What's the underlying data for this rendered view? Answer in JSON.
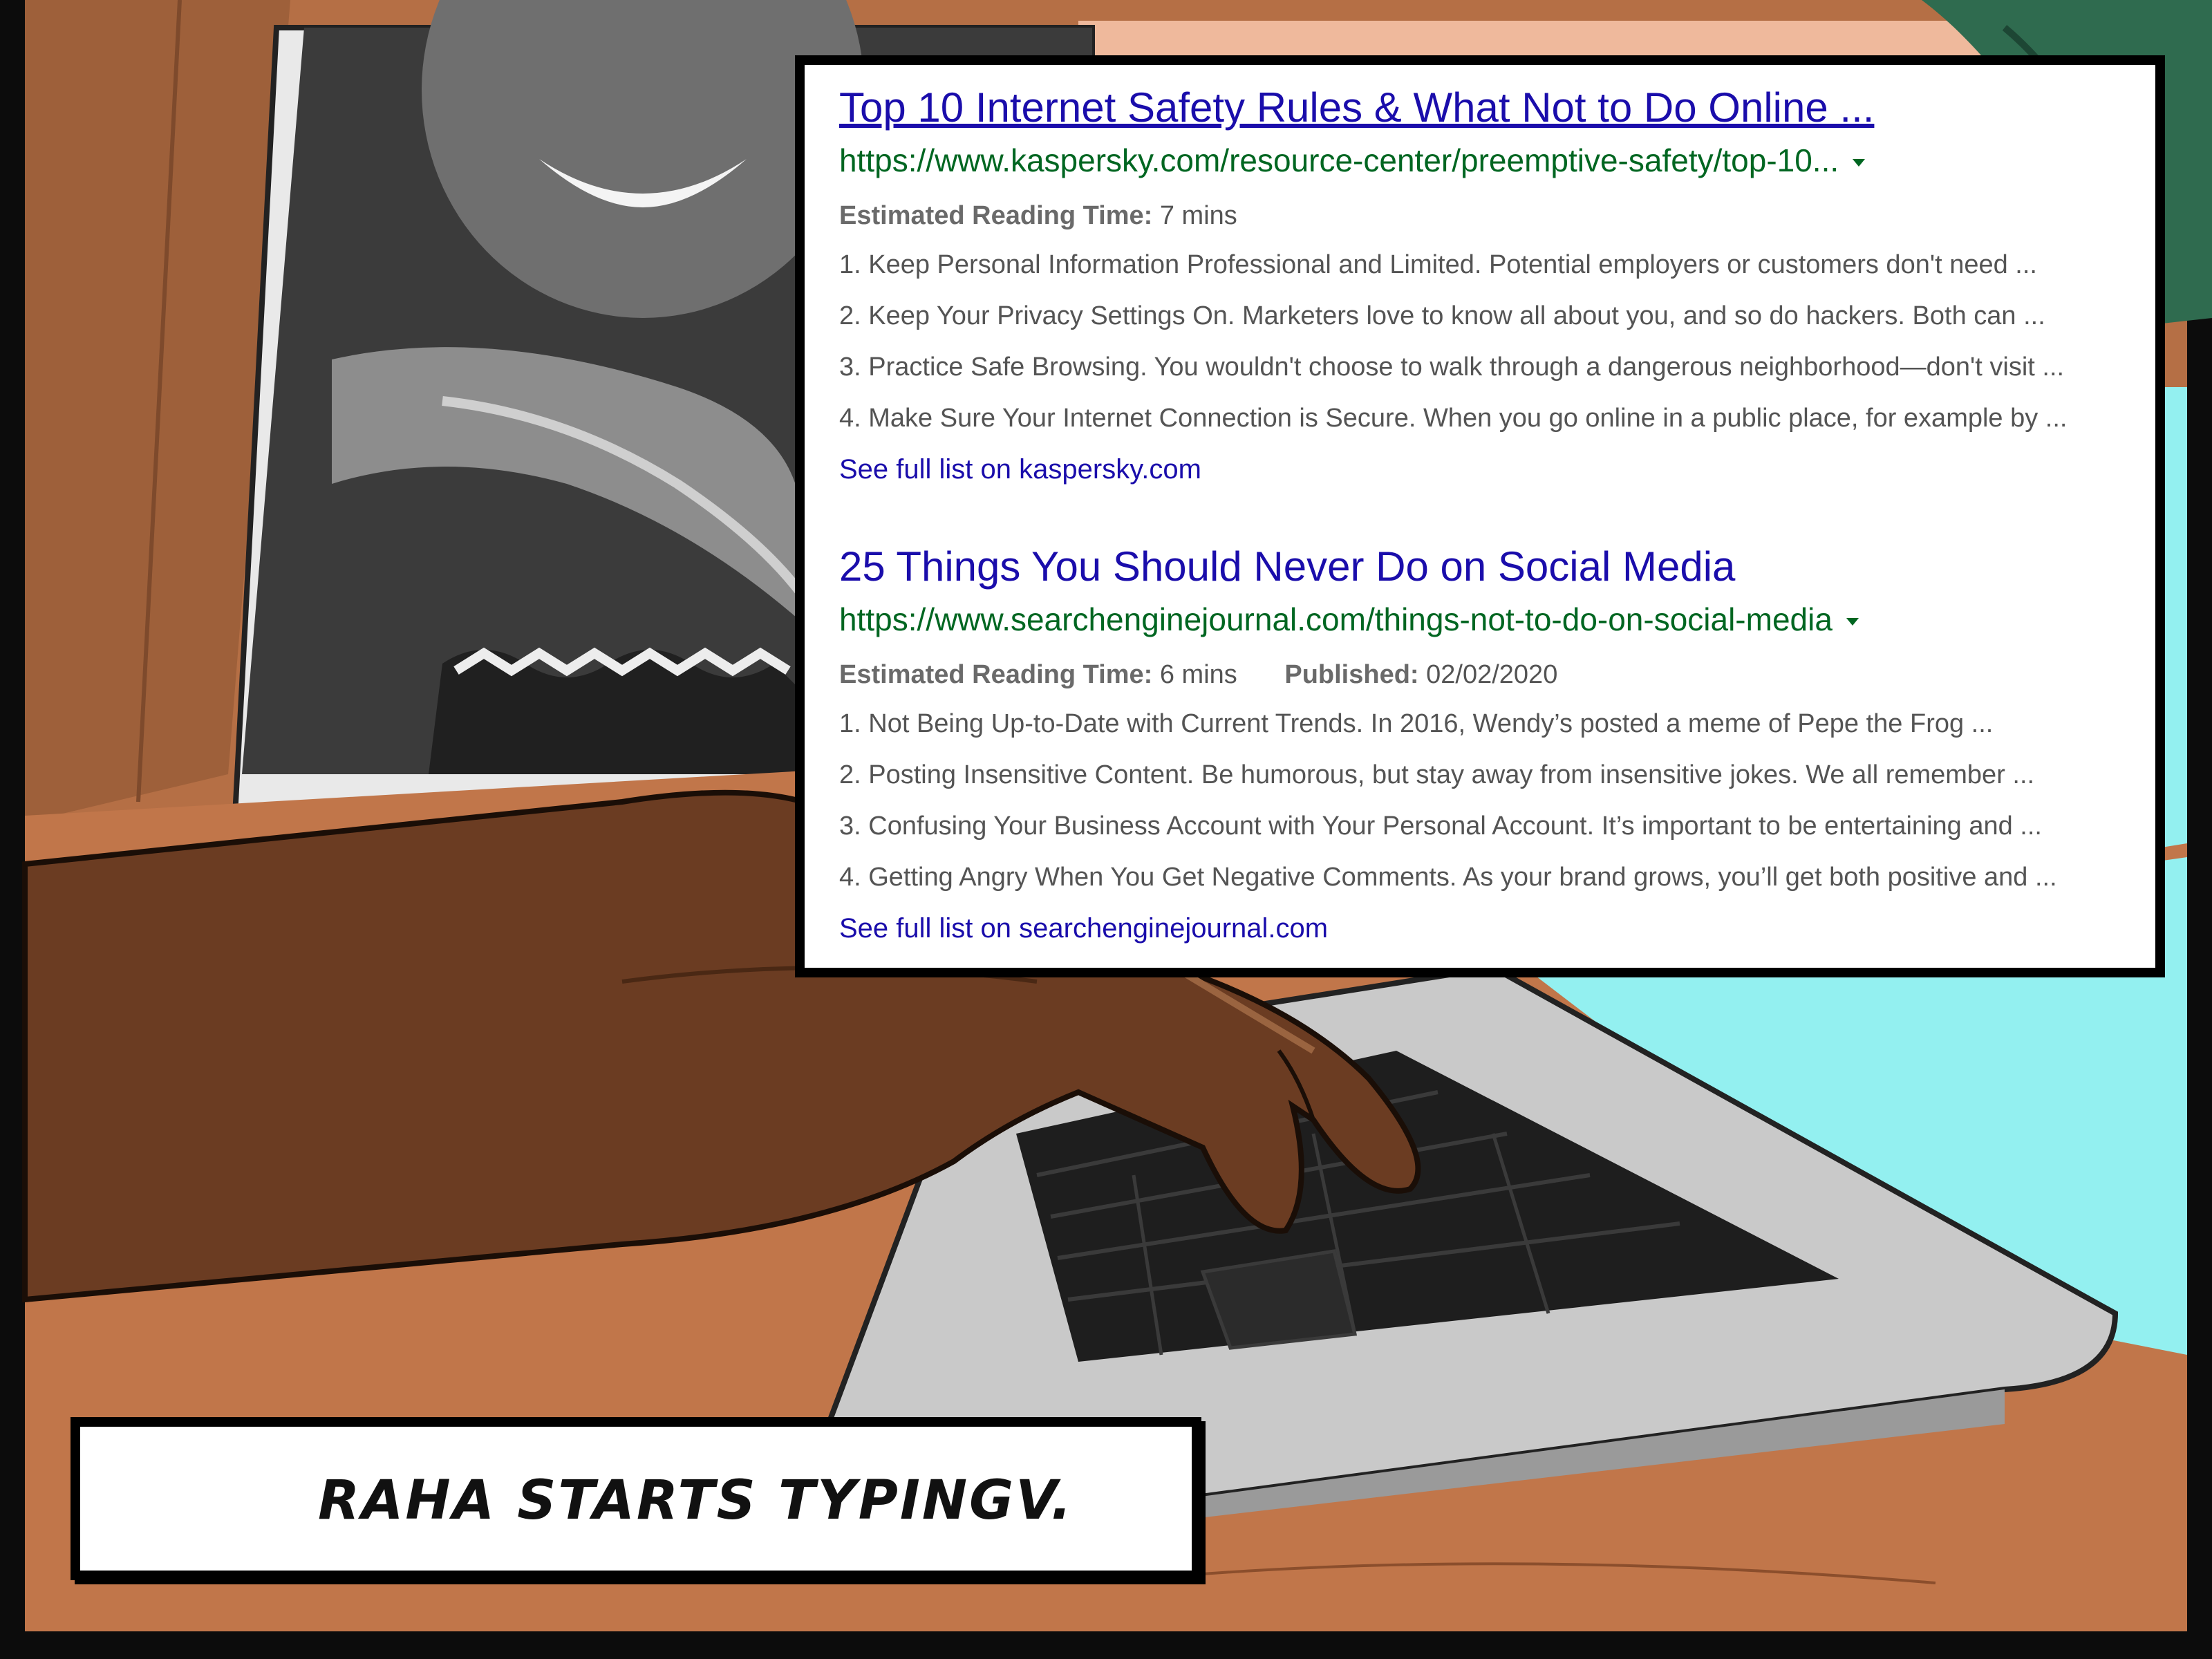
{
  "results": [
    {
      "title": "Top 10 Internet Safety Rules & What Not to Do Online ...",
      "url": "https://www.kaspersky.com/resource-center/preemptive-safety/top-10...",
      "meta": [
        {
          "label": "Estimated Reading Time:",
          "value": "7 mins"
        }
      ],
      "items": [
        "1. Keep Personal Information Professional and Limited. Potential employers or customers don't need ...",
        "2. Keep Your Privacy Settings On. Marketers love to know all about you, and so do hackers. Both can ...",
        "3. Practice Safe Browsing. You wouldn't choose to walk through a dangerous neighborhood—don't visit ...",
        "4. Make Sure Your Internet Connection is Secure. When you go online in a public place, for example by ..."
      ],
      "more": "See full list on kaspersky.com"
    },
    {
      "title": "25 Things You Should Never Do on Social Media",
      "url": "https://www.searchenginejournal.com/things-not-to-do-on-social-media",
      "meta": [
        {
          "label": "Estimated Reading Time:",
          "value": "6 mins"
        },
        {
          "label": "Published:",
          "value": "02/02/2020"
        }
      ],
      "items": [
        "1. Not Being Up-to-Date with Current Trends. In 2016, Wendy’s posted a meme of Pepe the Frog ...",
        "2. Posting Insensitive Content. Be humorous, but stay away from insensitive jokes. We all remember ...",
        "3. Confusing Your Business Account with Your Personal Account. It’s important to be entertaining and ...",
        "4. Getting Angry When You Get Negative Comments. As your brand grows, you’ll get both positive and ..."
      ],
      "more": "See full list on searchenginejournal.com"
    }
  ],
  "caption": "RAHA STARTS TYPINGV.",
  "colors": {
    "link": "#1a0dab",
    "url": "#006621",
    "snippet": "#545454",
    "desk": "#c1764a",
    "skin": "#6b3c22",
    "screen_glow": "#93f0f0",
    "laptop": "#c9c9c9",
    "keyboard": "#1e1e1e"
  }
}
